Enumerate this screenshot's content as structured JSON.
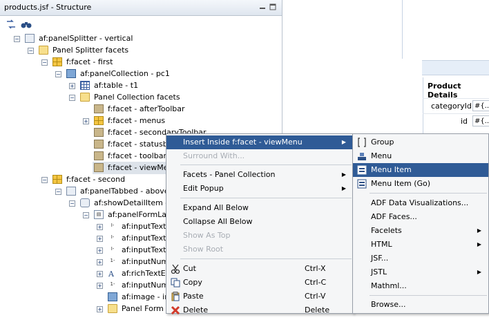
{
  "structure": {
    "title": "products.jsf - Structure",
    "tree": [
      {
        "label": "af:panelSplitter - vertical"
      },
      {
        "label": "Panel Splitter facets"
      },
      {
        "label": "f:facet - first"
      },
      {
        "label": "af:panelCollection - pc1"
      },
      {
        "label": "af:table - t1"
      },
      {
        "label": "Panel Collection facets"
      },
      {
        "label": "f:facet - afterToolbar"
      },
      {
        "label": "f:facet - menus"
      },
      {
        "label": "f:facet - secondaryToolbar"
      },
      {
        "label": "f:facet - statusbar"
      },
      {
        "label": "f:facet - toolbar"
      },
      {
        "label": "f:facet - viewMenu"
      },
      {
        "label": "f:facet - second"
      },
      {
        "label": "af:panelTabbed - above"
      },
      {
        "label": "af:showDetailItem - P"
      },
      {
        "label": "af:panelFormLay"
      },
      {
        "label": "af:inputText"
      },
      {
        "label": "af:inputText"
      },
      {
        "label": "af:inputText"
      },
      {
        "label": "af:inputNumb"
      },
      {
        "label": "af:richTextEd"
      },
      {
        "label": "af:inputNumb"
      },
      {
        "label": "af:image - im"
      },
      {
        "label": "Panel Form L"
      }
    ]
  },
  "details": {
    "title": "Product Details",
    "rows": [
      {
        "label": "categoryId",
        "value": "#{..."
      },
      {
        "label": "id",
        "value": "#{..."
      }
    ]
  },
  "context_menu": {
    "items": [
      {
        "label": "Insert Inside f:facet - viewMenu",
        "u": "I",
        "shortcut": "",
        "submenu": true
      },
      {
        "label": "Surround With...",
        "u": "",
        "shortcut": "",
        "submenu": false
      },
      {
        "label": "Facets - Panel Collection",
        "u": "",
        "shortcut": "",
        "submenu": true
      },
      {
        "label": "Edit Popup",
        "u": "E",
        "shortcut": "",
        "submenu": true
      },
      {
        "label": "Expand All Below",
        "u": "E",
        "shortcut": "",
        "submenu": false
      },
      {
        "label": "Collapse All Below",
        "u": "C",
        "shortcut": "",
        "submenu": false
      },
      {
        "label": "Show As Top",
        "u": "",
        "shortcut": "",
        "submenu": false
      },
      {
        "label": "Show Root",
        "u": "",
        "shortcut": "",
        "submenu": false
      },
      {
        "label": "Cut",
        "u": "u",
        "shortcut": "Ctrl-X",
        "submenu": false
      },
      {
        "label": "Copy",
        "u": "C",
        "shortcut": "Ctrl-C",
        "submenu": false
      },
      {
        "label": "Paste",
        "u": "P",
        "shortcut": "Ctrl-V",
        "submenu": false
      },
      {
        "label": "Delete",
        "u": "",
        "shortcut": "Delete",
        "submenu": false
      }
    ]
  },
  "submenu": {
    "items": [
      {
        "label": "Group"
      },
      {
        "label": "Menu"
      },
      {
        "label": "Menu Item"
      },
      {
        "label": "Menu Item (Go)"
      },
      {
        "label": "ADF Data Visualizations..."
      },
      {
        "label": "ADF Faces..."
      },
      {
        "label": "Facelets"
      },
      {
        "label": "HTML"
      },
      {
        "label": "JSF..."
      },
      {
        "label": "JSTL"
      },
      {
        "label": "Mathml..."
      },
      {
        "label": "Browse..."
      }
    ]
  },
  "colors": {
    "selection": "#2f5b96",
    "menu_bg": "#f5f6f7"
  }
}
